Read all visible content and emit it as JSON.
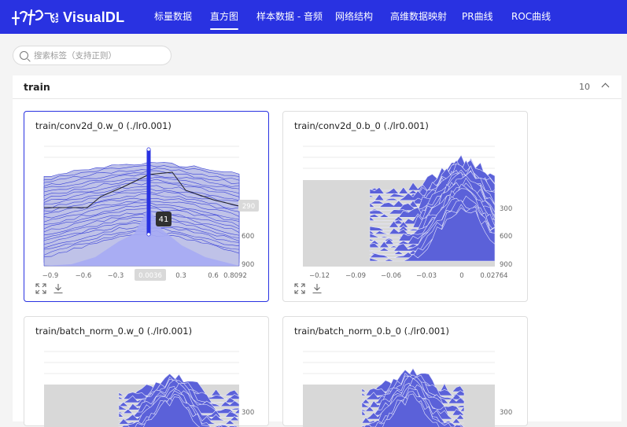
{
  "app": {
    "brand": "VisualDL",
    "logo_text": "飞桨"
  },
  "nav": {
    "items": [
      {
        "label": "标量数据"
      },
      {
        "label": "直方图"
      },
      {
        "label": "样本数据 - 音频"
      },
      {
        "label": "网络结构"
      },
      {
        "label": "高维数据映射"
      },
      {
        "label": "PR曲线"
      },
      {
        "label": "ROC曲线"
      }
    ],
    "active": "直方图"
  },
  "search": {
    "placeholder": "搜索标签（支持正则）",
    "value": ""
  },
  "group": {
    "title": "train",
    "count": "10"
  },
  "colors": {
    "nav_bg": "#2932e1",
    "series": "#5b61d9",
    "active_border": "#2932e1"
  },
  "cards": [
    {
      "title": "train/conv2d_0.w_0 (./lr0.001)",
      "x_ticks": [
        "−0.9",
        "−0.6",
        "−0.3",
        "0.0036",
        "0.3",
        "0.6",
        "0.8092"
      ],
      "y_ticks": [
        "290",
        "600",
        "900"
      ],
      "tooltip": "41",
      "highlight_x": "0.0036",
      "highlight_y": "290",
      "toolbar": {
        "fullscreen": "fullscreen-icon",
        "download": "download-icon"
      }
    },
    {
      "title": "train/conv2d_0.b_0 (./lr0.001)",
      "x_ticks": [
        "−0.12",
        "−0.09",
        "−0.06",
        "−0.03",
        "0",
        "0.02764"
      ],
      "y_ticks": [
        "300",
        "600",
        "900"
      ],
      "toolbar": {
        "fullscreen": "fullscreen-icon",
        "download": "download-icon"
      }
    },
    {
      "title": "train/batch_norm_0.w_0 (./lr0.001)",
      "y_ticks": [
        "300"
      ]
    },
    {
      "title": "train/batch_norm_0.b_0 (./lr0.001)",
      "y_ticks": [
        "300"
      ]
    }
  ]
}
